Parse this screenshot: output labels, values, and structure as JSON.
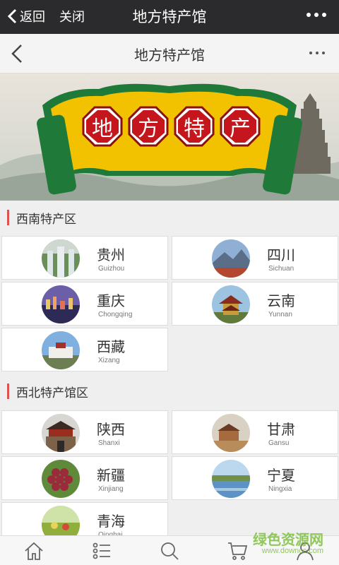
{
  "wechat_bar": {
    "back_label": "返回",
    "close_label": "关闭",
    "title": "地方特产馆"
  },
  "page_bar": {
    "title": "地方特产馆"
  },
  "banner": {
    "chars": [
      "地",
      "方",
      "特",
      "产"
    ]
  },
  "sections": [
    {
      "title": "西南特产区",
      "items": [
        {
          "name": "贵州",
          "pinyin": "Guizhou",
          "icon": "waterfall-photo"
        },
        {
          "name": "四川",
          "pinyin": "Sichuan",
          "icon": "mountain-lake-photo"
        },
        {
          "name": "重庆",
          "pinyin": "Chongqing",
          "icon": "city-night-photo"
        },
        {
          "name": "云南",
          "pinyin": "Yunnan",
          "icon": "pagoda-photo"
        },
        {
          "name": "西藏",
          "pinyin": "Xizang",
          "icon": "potala-palace-photo"
        }
      ]
    },
    {
      "title": "西北特产馆区",
      "items": [
        {
          "name": "陕西",
          "pinyin": "Shanxi",
          "icon": "city-gate-photo"
        },
        {
          "name": "甘肃",
          "pinyin": "Gansu",
          "icon": "fortress-photo"
        },
        {
          "name": "新疆",
          "pinyin": "Xinjiang",
          "icon": "grapes-photo"
        },
        {
          "name": "宁夏",
          "pinyin": "Ningxia",
          "icon": "wetland-photo"
        },
        {
          "name": "青海",
          "pinyin": "Qinghai",
          "icon": "grassland-photo"
        }
      ]
    }
  ],
  "tabbar": {
    "icons": [
      "home-icon",
      "list-icon",
      "search-icon",
      "cart-icon",
      "user-icon"
    ]
  },
  "watermark": {
    "text_cn": "绿色资源网",
    "text_url": "www.downcc.com"
  },
  "colors": {
    "top_bar": "#2b2b2d",
    "accent_red": "#d9534f",
    "banner_red": "#c4161c",
    "banner_yellow": "#f2c200",
    "banner_green": "#1f7a3a"
  }
}
